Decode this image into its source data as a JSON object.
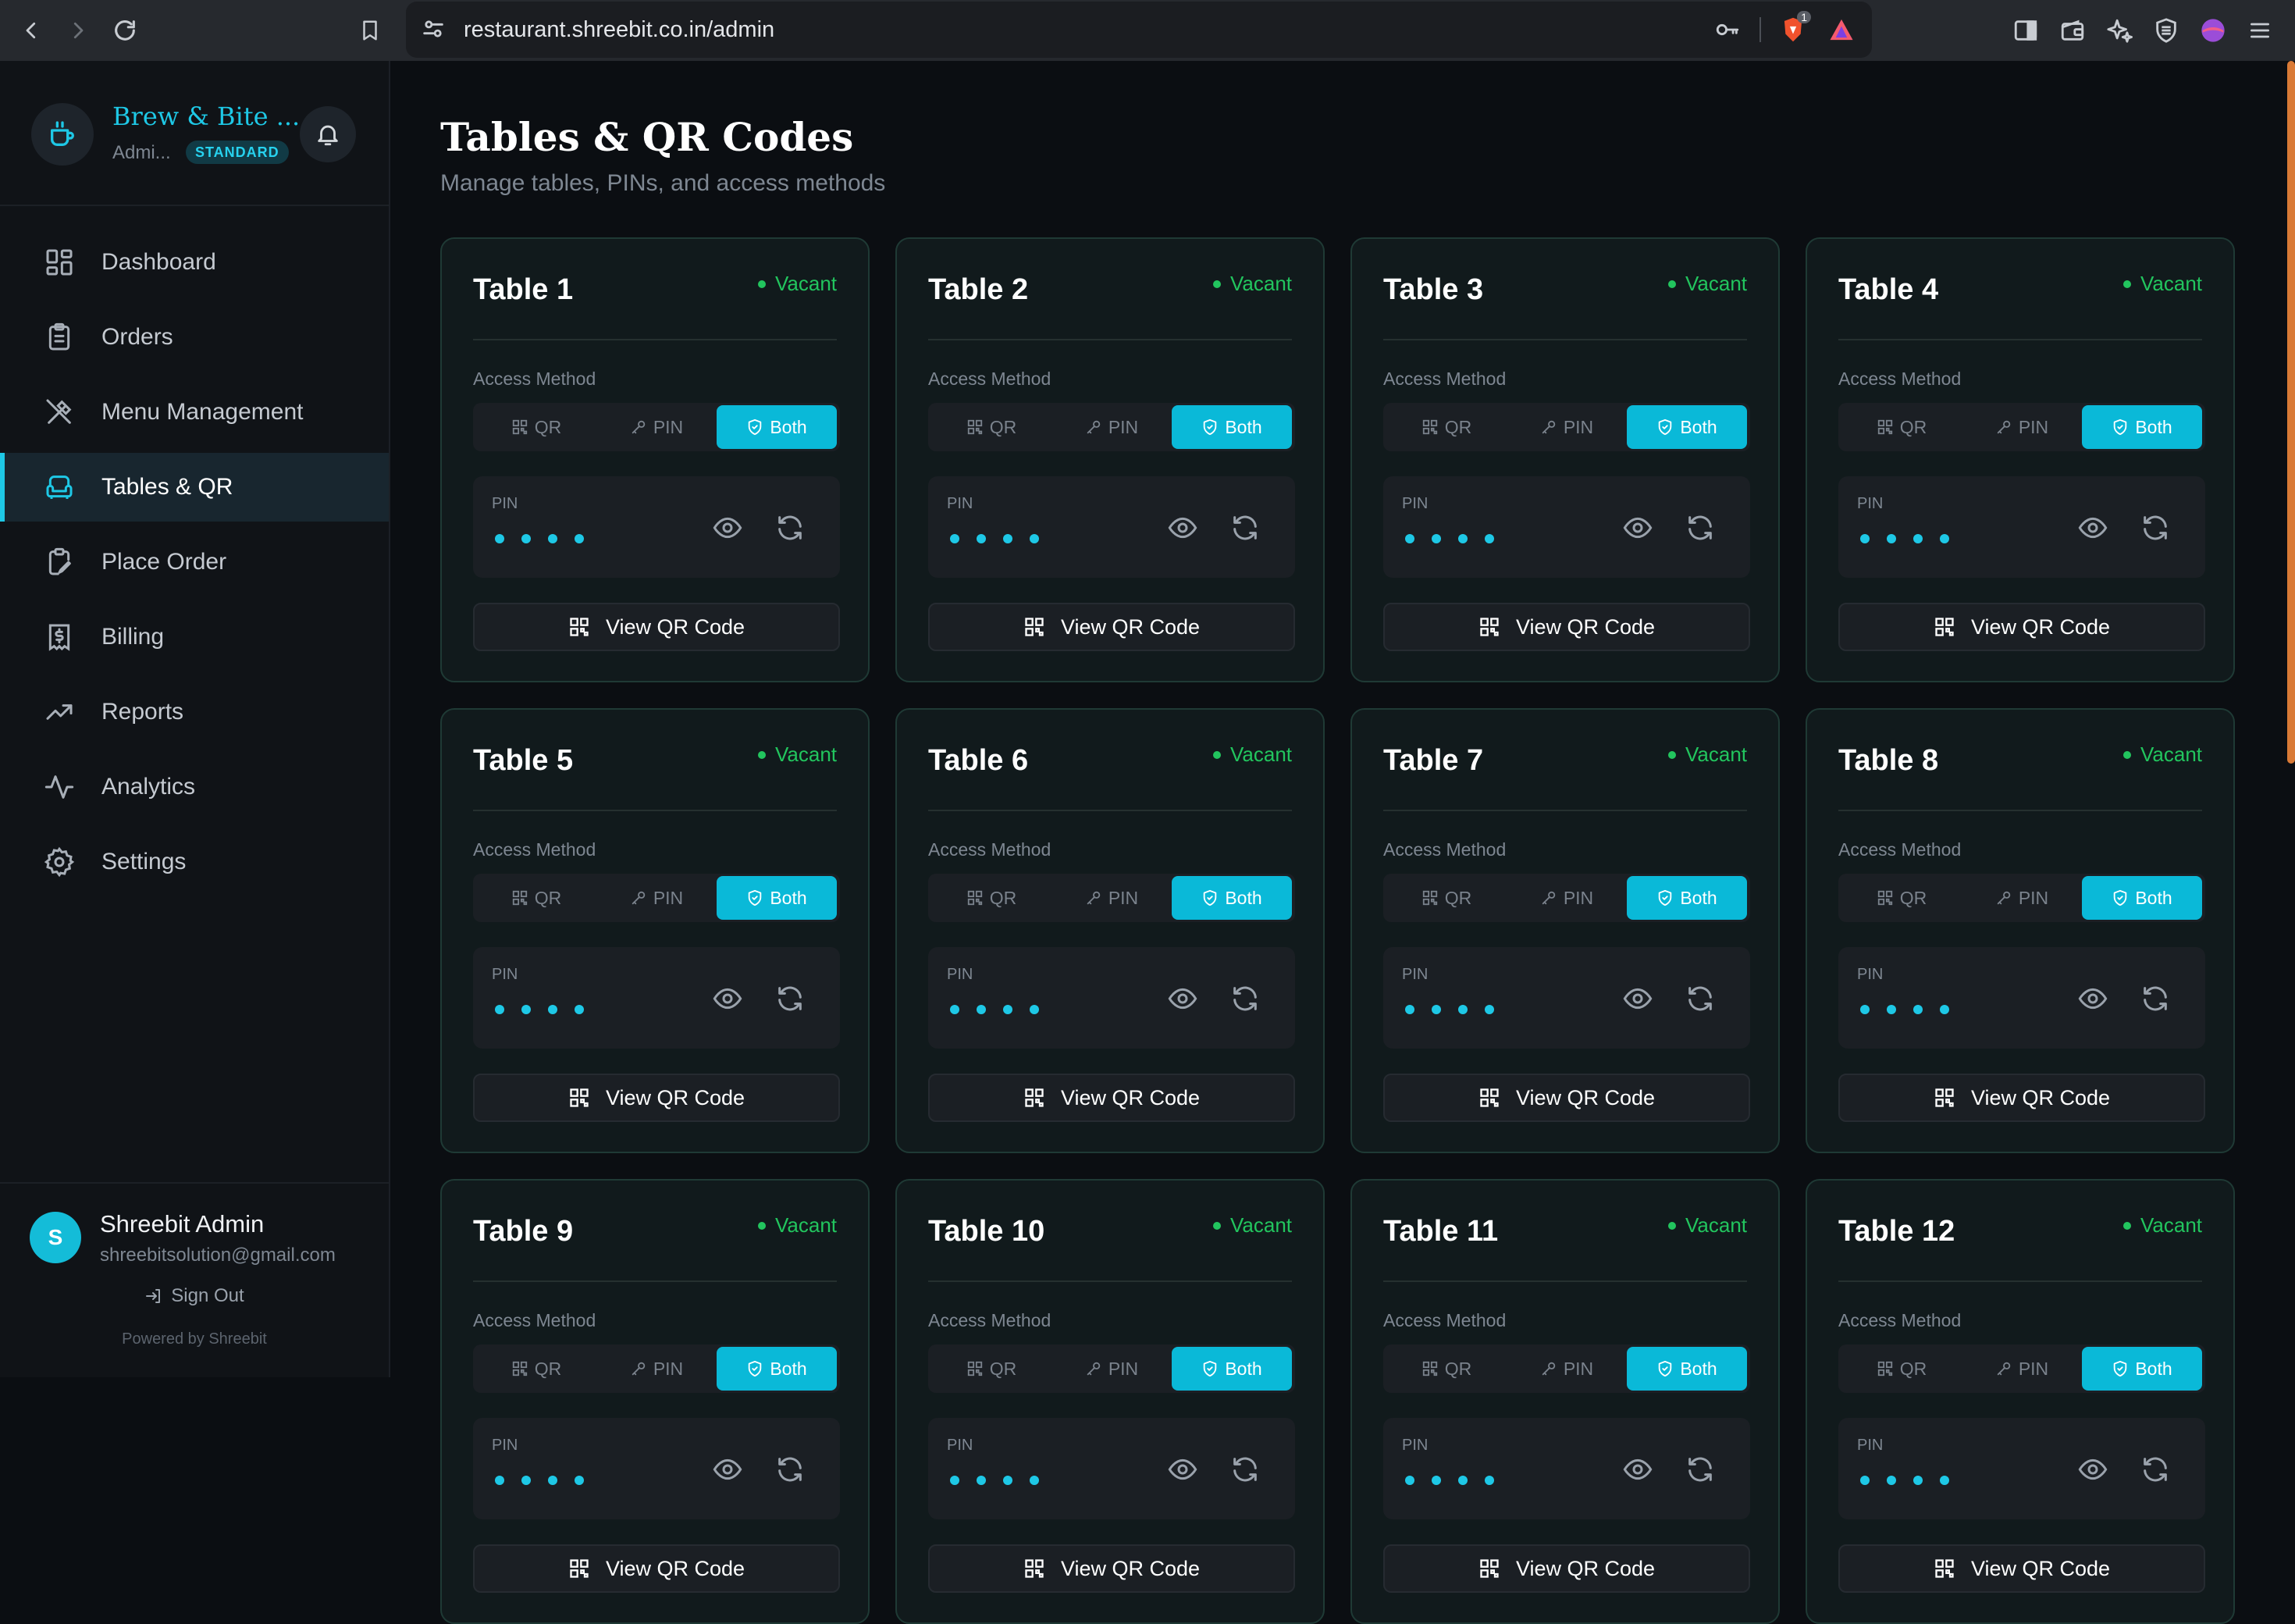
{
  "browser": {
    "url": "restaurant.shreebit.co.in/admin",
    "brave_badge": "1"
  },
  "sidebar": {
    "brand_name": "Brew & Bite ...",
    "brand_role": "Admi...",
    "plan_badge": "STANDARD",
    "items": [
      {
        "label": "Dashboard",
        "icon": "grid-icon"
      },
      {
        "label": "Orders",
        "icon": "clipboard-icon"
      },
      {
        "label": "Menu Management",
        "icon": "utensils-icon"
      },
      {
        "label": "Tables & QR",
        "icon": "armchair-icon"
      },
      {
        "label": "Place Order",
        "icon": "clipboard-pen-icon"
      },
      {
        "label": "Billing",
        "icon": "receipt-icon"
      },
      {
        "label": "Reports",
        "icon": "trend-up-icon"
      },
      {
        "label": "Analytics",
        "icon": "activity-icon"
      },
      {
        "label": "Settings",
        "icon": "gear-icon"
      }
    ],
    "active_item": "Tables & QR",
    "user": {
      "initial": "S",
      "name": "Shreebit Admin",
      "email": "shreebitsolution@gmail.com",
      "sign_out": "Sign Out",
      "powered_by": "Powered by Shreebit"
    }
  },
  "main": {
    "title": "Tables & QR Codes",
    "subtitle": "Manage tables, PINs, and access methods",
    "card_labels": {
      "access_method": "Access Method",
      "pin": "PIN",
      "view_qr": "View QR Code",
      "opt_qr": "QR",
      "opt_pin": "PIN",
      "opt_both": "Both"
    },
    "tables": [
      {
        "name": "Table 1",
        "status": "Vacant",
        "access": "Both"
      },
      {
        "name": "Table 2",
        "status": "Vacant",
        "access": "Both"
      },
      {
        "name": "Table 3",
        "status": "Vacant",
        "access": "Both"
      },
      {
        "name": "Table 4",
        "status": "Vacant",
        "access": "Both"
      },
      {
        "name": "Table 5",
        "status": "Vacant",
        "access": "Both"
      },
      {
        "name": "Table 6",
        "status": "Vacant",
        "access": "Both"
      },
      {
        "name": "Table 7",
        "status": "Vacant",
        "access": "Both"
      },
      {
        "name": "Table 8",
        "status": "Vacant",
        "access": "Both"
      },
      {
        "name": "Table 9",
        "status": "Vacant",
        "access": "Both"
      },
      {
        "name": "Table 10",
        "status": "Vacant",
        "access": "Both"
      },
      {
        "name": "Table 11",
        "status": "Vacant",
        "access": "Both"
      },
      {
        "name": "Table 12",
        "status": "Vacant",
        "access": "Both"
      }
    ]
  },
  "colors": {
    "accent": "#1ec8e6",
    "status_vacant": "#22c55e",
    "card_border": "#1f3a35",
    "background": "#0b0e12"
  }
}
